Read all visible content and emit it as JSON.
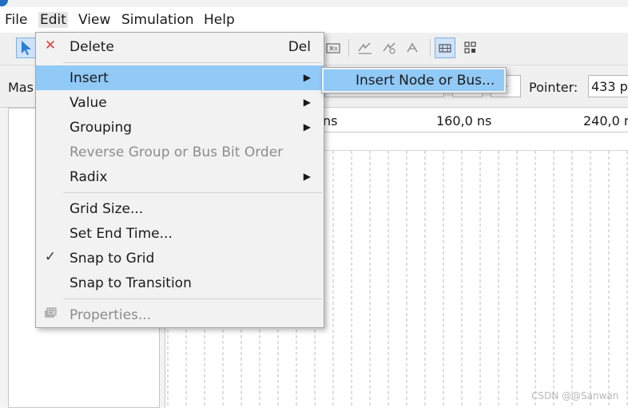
{
  "menubar": {
    "items": [
      {
        "label": "File"
      },
      {
        "label": "Edit"
      },
      {
        "label": "View"
      },
      {
        "label": "Simulation"
      },
      {
        "label": "Help"
      }
    ]
  },
  "header": {
    "master_label": "Mas",
    "pointer_label": "Pointer:",
    "pointer_value": "433 p"
  },
  "timeline": {
    "ticks": [
      "ns",
      "160,0 ns",
      "240,0 n"
    ]
  },
  "context_menu": {
    "delete": {
      "label": "Delete",
      "shortcut": "Del"
    },
    "insert": {
      "label": "Insert"
    },
    "value": {
      "label": "Value"
    },
    "grouping": {
      "label": "Grouping"
    },
    "reverse": {
      "label": "Reverse Group or Bus Bit Order"
    },
    "radix": {
      "label": "Radix"
    },
    "grid_size": {
      "label": "Grid Size..."
    },
    "set_end_time": {
      "label": "Set End Time..."
    },
    "snap_grid": {
      "label": "Snap to Grid",
      "checked": true
    },
    "snap_transition": {
      "label": "Snap to Transition"
    },
    "properties": {
      "label": "Properties..."
    }
  },
  "submenu": {
    "insert_node": {
      "label": "Insert Node or Bus..."
    }
  },
  "watermark": "CSDN @@Sanwan",
  "colors": {
    "highlight": "#91c9f7",
    "delete_icon": "#e0443c",
    "accent": "#1f6fc2"
  }
}
